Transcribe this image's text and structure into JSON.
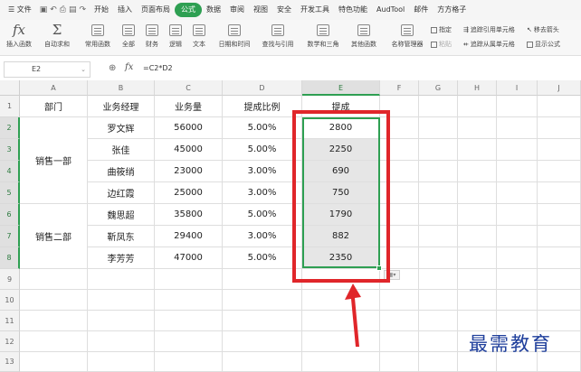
{
  "menubar": {
    "file_menu": "☰ 文件",
    "tabs": [
      "开始",
      "插入",
      "页面布局",
      "公式",
      "数据",
      "审阅",
      "视图",
      "安全",
      "开发工具",
      "特色功能",
      "AudTool",
      "邮件",
      "方方格子"
    ],
    "active_tab": "公式"
  },
  "ribbon": {
    "insert_function": "插入函数",
    "autosum": "自动求和",
    "common_functions": "常用函数",
    "all": "全部",
    "financial": "财务",
    "logical": "逻辑",
    "text": "文本",
    "datetime": "日期和时间",
    "lookup": "查找与引用",
    "math": "数学和三角",
    "other": "其他函数",
    "name_manager": "名称管理器",
    "specify": "指定",
    "paste": "粘贴",
    "trace_precedents": "追踪引用单元格",
    "trace_dependents": "追踪从属单元格",
    "remove_arrows": "移去箭头",
    "show_formulas": "显示公式"
  },
  "formula_bar": {
    "cell_ref": "E2",
    "fx_label": "fx",
    "formula": "=C2*D2"
  },
  "grid": {
    "columns": [
      "A",
      "B",
      "C",
      "D",
      "E",
      "F",
      "G",
      "H",
      "I",
      "J"
    ],
    "rows": [
      "1",
      "2",
      "3",
      "4",
      "5",
      "6",
      "7",
      "8",
      "9",
      "10",
      "11",
      "12",
      "13"
    ],
    "headers": {
      "dept": "部门",
      "manager": "业务经理",
      "volume": "业务量",
      "rate": "提成比例",
      "commission": "提成"
    },
    "dept_1": "销售一部",
    "dept_2": "销售二部",
    "records": [
      {
        "manager": "罗文辉",
        "volume": "56000",
        "rate": "5.00%",
        "commission": "2800"
      },
      {
        "manager": "张佳",
        "volume": "45000",
        "rate": "5.00%",
        "commission": "2250"
      },
      {
        "manager": "曲筱绡",
        "volume": "23000",
        "rate": "3.00%",
        "commission": "690"
      },
      {
        "manager": "边红霞",
        "volume": "25000",
        "rate": "3.00%",
        "commission": "750"
      },
      {
        "manager": "魏思超",
        "volume": "35800",
        "rate": "5.00%",
        "commission": "1790"
      },
      {
        "manager": "靳凤东",
        "volume": "29400",
        "rate": "3.00%",
        "commission": "882"
      },
      {
        "manager": "李芳芳",
        "volume": "47000",
        "rate": "5.00%",
        "commission": "2350"
      }
    ]
  },
  "watermark": "最需教育",
  "colors": {
    "accent": "#2e9f52",
    "highlight_border": "#e0262a",
    "watermark": "#1f3f9c"
  }
}
